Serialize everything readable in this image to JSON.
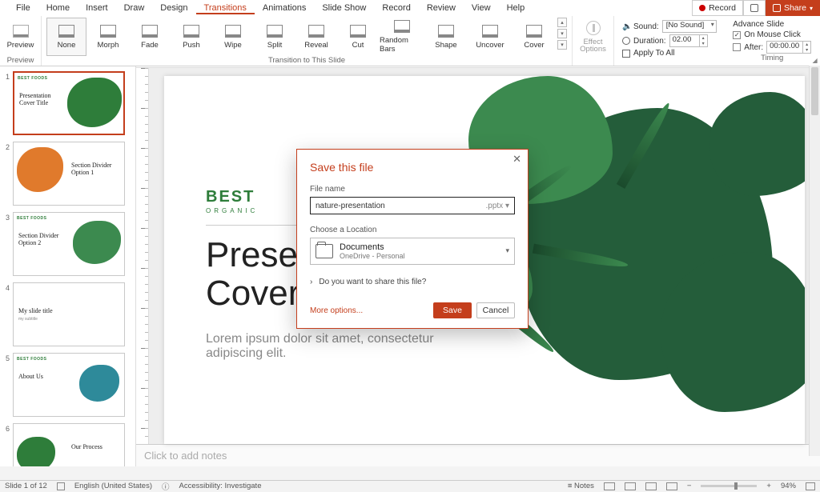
{
  "titlebar": {
    "record": "Record",
    "share": "Share"
  },
  "menu": {
    "items": [
      "File",
      "Home",
      "Insert",
      "Draw",
      "Design",
      "Transitions",
      "Animations",
      "Slide Show",
      "Record",
      "Review",
      "View",
      "Help"
    ],
    "active_index": 5
  },
  "ribbon": {
    "preview": {
      "label": "Preview",
      "group": "Preview"
    },
    "transitions_group_label": "Transition to This Slide",
    "transitions": [
      {
        "label": "None",
        "selected": true
      },
      {
        "label": "Morph"
      },
      {
        "label": "Fade"
      },
      {
        "label": "Push"
      },
      {
        "label": "Wipe"
      },
      {
        "label": "Split"
      },
      {
        "label": "Reveal"
      },
      {
        "label": "Cut"
      },
      {
        "label": "Random Bars"
      },
      {
        "label": "Shape"
      },
      {
        "label": "Uncover"
      },
      {
        "label": "Cover"
      }
    ],
    "effect_options": "Effect Options",
    "timing": {
      "group_label": "Timing",
      "sound_label": "Sound:",
      "sound_value": "[No Sound]",
      "duration_label": "Duration:",
      "duration_value": "02.00",
      "apply_all": "Apply To All",
      "advance_label": "Advance Slide",
      "on_click": "On Mouse Click",
      "on_click_checked": true,
      "after_label": "After:",
      "after_checked": false,
      "after_value": "00:00.00"
    }
  },
  "thumbnails": [
    {
      "n": 1,
      "title": "Presentation Cover Title",
      "brand": "BEST FOODS",
      "selected": true,
      "splat": "green-right"
    },
    {
      "n": 2,
      "title": "Section Divider Option 1",
      "splat": "orange-left"
    },
    {
      "n": 3,
      "title": "Section Divider Option 2",
      "brand": "BEST FOODS",
      "splat": "green-right2"
    },
    {
      "n": 4,
      "title": "My slide title",
      "sub": "my subtitle"
    },
    {
      "n": 5,
      "title": "About Us",
      "brand": "BEST FOODS",
      "splat": "teal-right"
    },
    {
      "n": 6,
      "title": "Our Process",
      "splat": "green-left"
    }
  ],
  "slide": {
    "brand": "BEST",
    "brand_full": "BEST FOODS",
    "brand_sub": "ORGANIC",
    "cover_line1": "Presentation",
    "cover_line2": "Cover ",
    "cover_italic": "Title",
    "lorem": "Lorem ipsum dolor sit amet, consectetur adipiscing elit."
  },
  "notes_placeholder": "Click to add notes",
  "statusbar": {
    "slide": "Slide 1 of 12",
    "lang": "English (United States)",
    "access": "Accessibility: Investigate",
    "notes": "Notes",
    "zoom": "94%"
  },
  "modal": {
    "title": "Save this file",
    "filename_label": "File name",
    "filename_value": "nature-presentation",
    "filename_ext": ".pptx",
    "location_label": "Choose a Location",
    "location_name": "Documents",
    "location_sub": "OneDrive - Personal",
    "share_question": "Do you want to share this file?",
    "more": "More options...",
    "save": "Save",
    "cancel": "Cancel"
  }
}
